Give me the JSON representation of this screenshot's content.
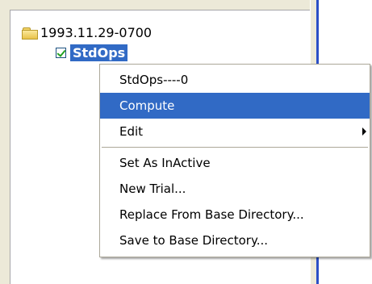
{
  "tree": {
    "root": {
      "label": "1993.11.29-0700",
      "icon": "folder-icon"
    },
    "child": {
      "label": "StdOps",
      "checked": true,
      "selected": true,
      "icon": "checkbox-checked-icon"
    }
  },
  "context_menu": {
    "items": [
      {
        "label": "StdOps----0",
        "highlighted": false
      },
      {
        "label": "Compute",
        "highlighted": true
      },
      {
        "label": "Edit",
        "has_submenu": true
      }
    ],
    "items_after_separator": [
      {
        "label": "Set As InActive"
      },
      {
        "label": "New Trial..."
      },
      {
        "label": "Replace From Base Directory..."
      },
      {
        "label": "Save to Base Directory..."
      }
    ],
    "icons": {
      "submenu": "chevron-right-icon"
    }
  },
  "colors": {
    "selection": "#316ac5",
    "panel_background": "#ffffff",
    "frame": "#ece9d8",
    "menu_border": "#aca899"
  }
}
